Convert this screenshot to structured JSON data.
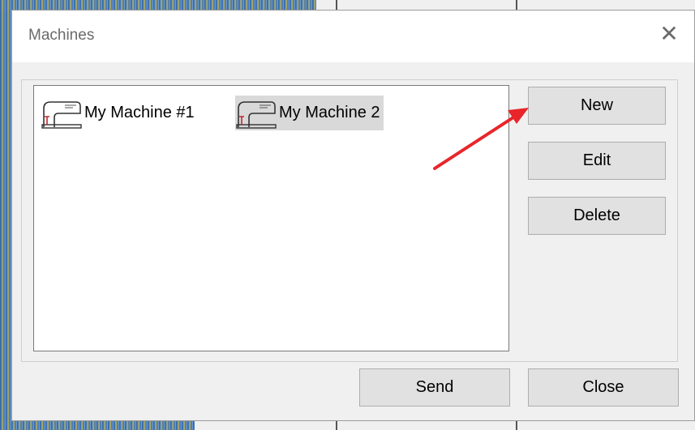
{
  "window": {
    "title": "Machines",
    "close_glyph": "✕"
  },
  "machines": {
    "items": [
      {
        "label": "My Machine #1",
        "icon": "sewing-machine-icon",
        "selected": false
      },
      {
        "label": "My Machine 2",
        "icon": "sewing-machine-icon",
        "selected": true
      }
    ]
  },
  "buttons": {
    "new": "New",
    "edit": "Edit",
    "delete": "Delete",
    "send": "Send",
    "close": "Close"
  },
  "annotation": {
    "icon": "red-arrow-icon",
    "color": "#e8262a",
    "points_to": "New"
  },
  "colors": {
    "dialog_bg": "#f0f0f0",
    "button_bg": "#e1e1e1",
    "selection_bg": "#d9d9d9"
  }
}
